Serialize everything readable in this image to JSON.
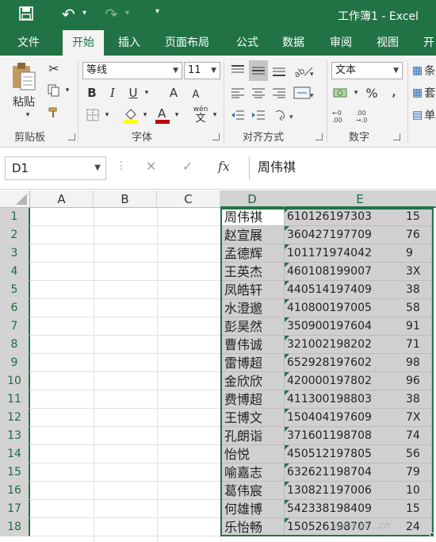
{
  "window": {
    "title": "工作簿1 - Excel",
    "quick_access": {
      "save_icon": "save-icon",
      "undo_icon": "undo-icon",
      "redo_icon": "redo-icon",
      "customize_icon": "customize-icon"
    }
  },
  "ribbon_tabs": [
    "文件",
    "开始",
    "插入",
    "页面布局",
    "公式",
    "数据",
    "审阅",
    "视图",
    "开"
  ],
  "active_tab": "开始",
  "ribbon": {
    "clipboard": {
      "label": "剪贴板",
      "paste": "粘贴"
    },
    "font": {
      "label": "字体",
      "name": "等线",
      "size": "11",
      "bold": "B",
      "italic": "I",
      "underline": "U",
      "grow": "A",
      "shrink": "A",
      "wen": "wén",
      "wen_char": "文"
    },
    "alignment": {
      "label": "对齐方式"
    },
    "number": {
      "label": "数字",
      "format": "文本",
      "percent": "%"
    },
    "styles": {
      "cut1": "条",
      "cut2": "套",
      "cut3": "单"
    }
  },
  "formula_bar": {
    "name_box": "D1",
    "cancel": "✕",
    "enter": "✓",
    "fx": "fx",
    "value": "周伟祺"
  },
  "grid": {
    "columns": [
      "A",
      "B",
      "C",
      "D",
      "E"
    ],
    "selected_columns": [
      "D",
      "E"
    ],
    "rows": [
      {
        "num": "1",
        "name": "周伟祺",
        "id": "610126197303",
        "tail": "15"
      },
      {
        "num": "2",
        "name": "赵宣展",
        "id": "360427197709",
        "tail": "76"
      },
      {
        "num": "3",
        "name": "孟德辉",
        "id": "101171974042",
        "tail": "9"
      },
      {
        "num": "4",
        "name": "王英杰",
        "id": "460108199007",
        "tail": "3X"
      },
      {
        "num": "5",
        "name": "凤皓轩",
        "id": "440514197409",
        "tail": "38"
      },
      {
        "num": "6",
        "name": "水澄邈",
        "id": "410800197005",
        "tail": "58"
      },
      {
        "num": "7",
        "name": "彭昊然",
        "id": "350900197604",
        "tail": "91"
      },
      {
        "num": "8",
        "name": "曹伟诚",
        "id": "321002198202",
        "tail": "71"
      },
      {
        "num": "9",
        "name": "雷博超",
        "id": "652928197602",
        "tail": "98"
      },
      {
        "num": "10",
        "name": "金欣欣",
        "id": "420000197802",
        "tail": "96"
      },
      {
        "num": "11",
        "name": "费博超",
        "id": "411300198803",
        "tail": "38"
      },
      {
        "num": "12",
        "name": "王博文",
        "id": "150404197609",
        "tail": "7X"
      },
      {
        "num": "13",
        "name": "孔朗诣",
        "id": "371601198708",
        "tail": "74"
      },
      {
        "num": "14",
        "name": "怡悦",
        "id": "450512197805",
        "tail": "56"
      },
      {
        "num": "15",
        "name": "喻嘉志",
        "id": "632621198704",
        "tail": "79"
      },
      {
        "num": "16",
        "name": "葛伟宸",
        "id": "130821197006",
        "tail": "10"
      },
      {
        "num": "17",
        "name": "何雄博",
        "id": "542338198409",
        "tail": "15"
      },
      {
        "num": "18",
        "name": "乐怡畅",
        "id": "150526198707",
        "tail": "24"
      }
    ]
  },
  "watermark": "www.pc...cn",
  "colors": {
    "excel_green": "#217346",
    "selection_gray": "#d0d0d0",
    "font_red": "#c00000",
    "highlight_yellow": "#ffff00"
  }
}
